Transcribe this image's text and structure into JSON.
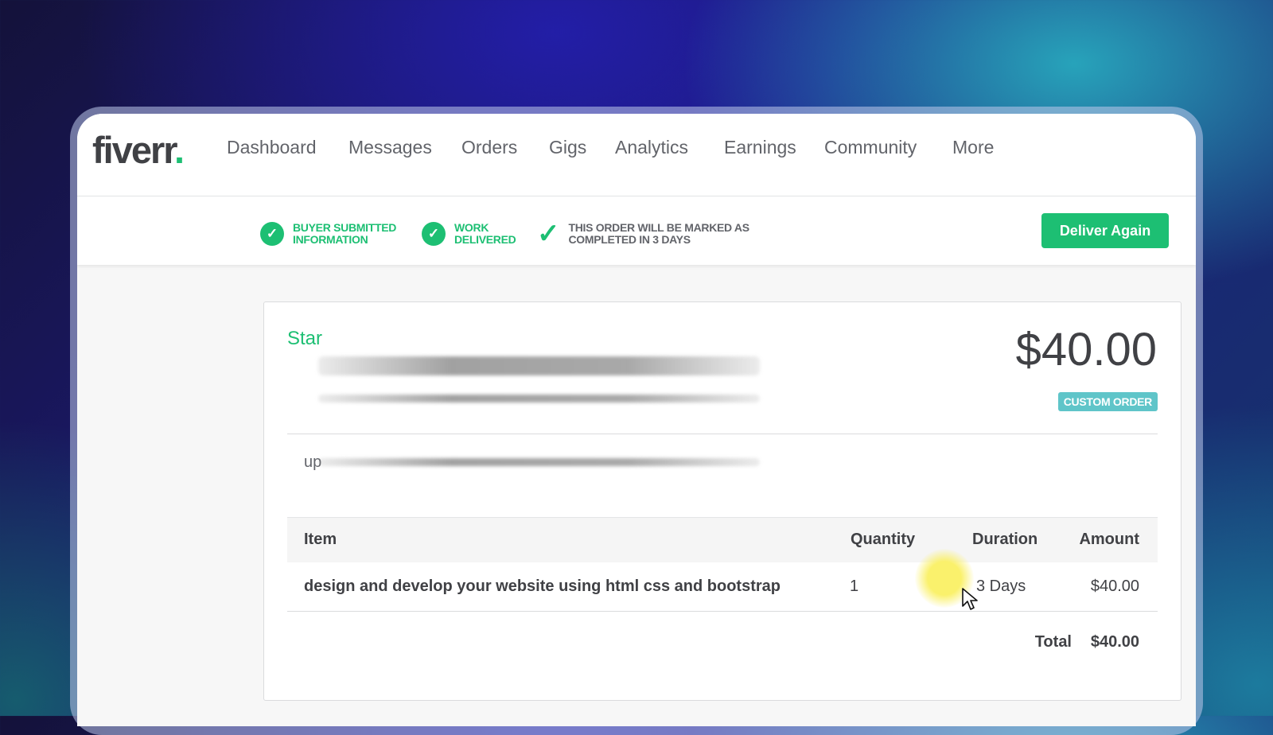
{
  "app": {
    "logo_text": "fiverr",
    "logo_dot": ".",
    "brand_color": "#1dbf73"
  },
  "nav": {
    "items": [
      "Dashboard",
      "Messages",
      "Orders",
      "Gigs",
      "Analytics",
      "Earnings",
      "Community",
      "More"
    ]
  },
  "status": {
    "steps": [
      {
        "line1": "Buyer submitted",
        "line2": "information",
        "icon": "check-circle-icon"
      },
      {
        "line1": "Work",
        "line2": "delivered",
        "icon": "check-circle-icon"
      },
      {
        "line1": "This order will be marked as",
        "line2": "completed in 3 days",
        "icon": "check-icon"
      }
    ],
    "deliver_button": "Deliver Again"
  },
  "order": {
    "buyer_name": "Star",
    "price": "$40.00",
    "badge": "Custom Order",
    "badge_color": "#5fc5c9",
    "requirement_prefix": "up",
    "table": {
      "headers": {
        "item": "Item",
        "quantity": "Quantity",
        "duration": "Duration",
        "amount": "Amount"
      },
      "row": {
        "item": "design and develop your website using html css and bootstrap",
        "quantity": "1",
        "duration": "3 Days",
        "amount": "$40.00"
      },
      "total_label": "Total",
      "total_value": "$40.00"
    }
  }
}
